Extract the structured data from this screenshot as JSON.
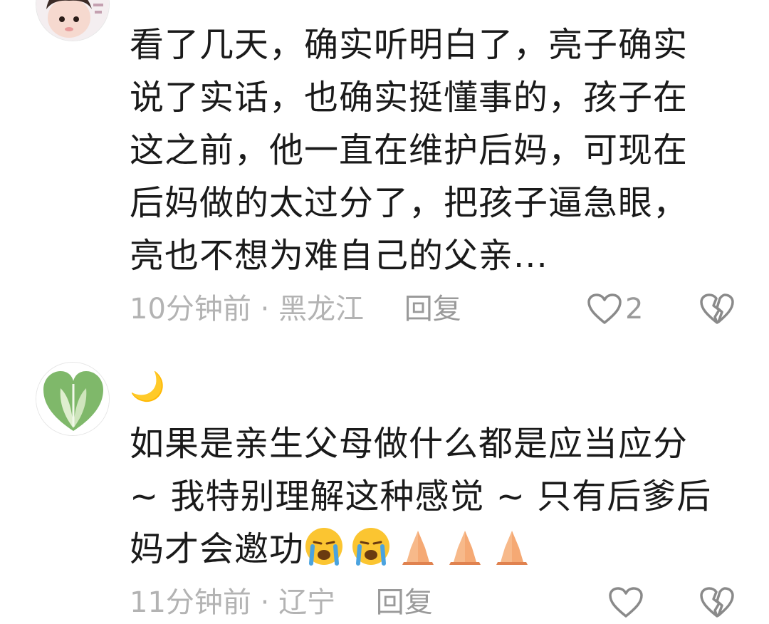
{
  "comments": [
    {
      "nickname": "",
      "text": "看了几天，确实听明白了，亮子确实说了实话，也确实挺懂事的，孩子在这之前，他一直在维护后妈，可现在后妈做的太过分了，把孩子逼急眼，亮也不想为难自己的父亲...",
      "time": "10分钟前",
      "separator": "·",
      "location": "黑龙江",
      "reply_label": "回复",
      "like_count": "2"
    },
    {
      "nickname": "🌙",
      "text": "如果是亲生父母做什么都是应当应分 ~ 我特别理解这种感觉 ~ 只有后爹后妈才会邀功",
      "emojis": [
        "loudly-crying-face",
        "loudly-crying-face",
        "folded-hands",
        "folded-hands",
        "folded-hands"
      ],
      "time": "11分钟前",
      "separator": "·",
      "location": "辽宁",
      "reply_label": "回复",
      "like_count": ""
    }
  ],
  "colors": {
    "text": "#1a1a1a",
    "meta": "#b3b3b3",
    "reply": "#9a9a9a",
    "icon": "#8a8a8a"
  }
}
